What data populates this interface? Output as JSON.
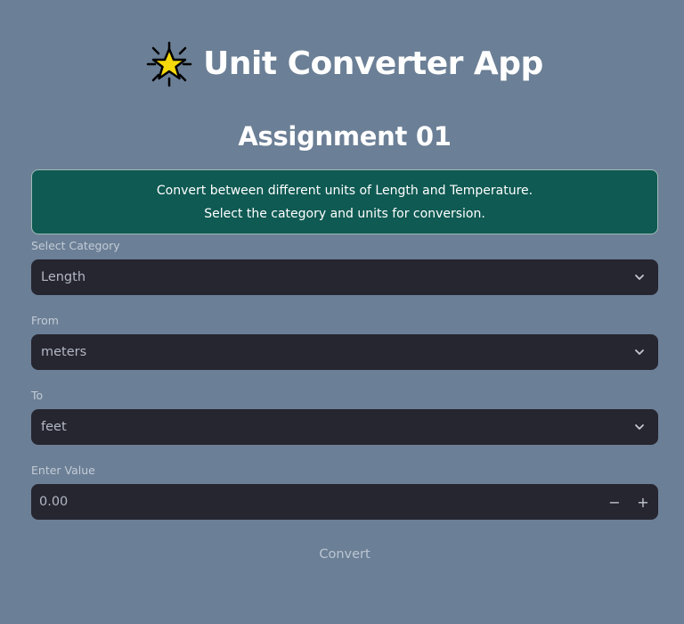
{
  "header": {
    "title": "Unit Converter App",
    "title_icon": "star-icon",
    "subtitle": "Assignment 01"
  },
  "info": {
    "line1": "Convert between different units of Length and Temperature.",
    "line2": "Select the category and units for conversion."
  },
  "category": {
    "label": "Select Category",
    "value": "Length"
  },
  "from": {
    "label": "From",
    "value": "meters"
  },
  "to": {
    "label": "To",
    "value": "feet"
  },
  "value_input": {
    "label": "Enter Value",
    "value": "0.00",
    "decrement": "−",
    "increment": "+"
  },
  "convert_label": "Convert",
  "colors": {
    "background": "#6b7f96",
    "info_box": "#0f5a53",
    "input_bg": "#262630",
    "star_fill": "#f5d90a"
  }
}
